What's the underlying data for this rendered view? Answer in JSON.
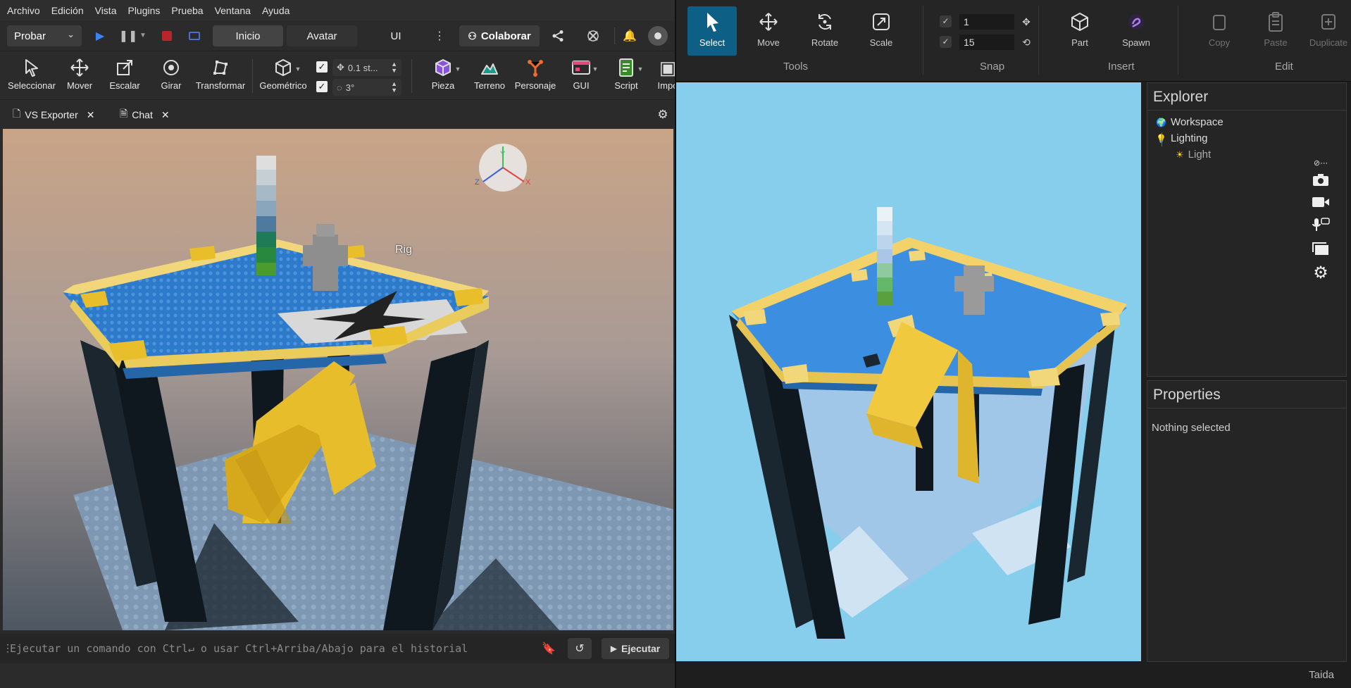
{
  "left_app": {
    "menu": [
      "Archivo",
      "Edición",
      "Vista",
      "Plugins",
      "Prueba",
      "Ventana",
      "Ayuda"
    ],
    "test_dropdown": "Probar",
    "modes": {
      "home": "Inicio",
      "avatar": "Avatar",
      "ui": "UI"
    },
    "collaborate": "Colaborar",
    "tools": {
      "select": "Seleccionar",
      "move": "Mover",
      "scale": "Escalar",
      "rotate": "Girar",
      "transform": "Transformar",
      "geometric": "Geométrico"
    },
    "snap": {
      "move": "0.1 st...",
      "rotate": "3°"
    },
    "insert": {
      "part": "Pieza",
      "terrain": "Terreno",
      "character": "Personaje",
      "gui": "GUI",
      "script": "Script",
      "import": "Impo"
    },
    "tabs": [
      "VS Exporter",
      "Chat"
    ],
    "viewport_label": "Rig",
    "gizmo": {
      "x": "X",
      "y": "Y",
      "z": "Z"
    },
    "command_placeholder": "Ejecutar un comando con Ctrl↵ o usar Ctrl+Arriba/Abajo para el historial",
    "run": "Ejecutar"
  },
  "right_app": {
    "tools": {
      "select": "Select",
      "move": "Move",
      "rotate": "Rotate",
      "scale": "Scale",
      "group": "Tools"
    },
    "snap": {
      "move_value": "1",
      "rotate_value": "15",
      "group": "Snap"
    },
    "insert": {
      "part": "Part",
      "spawn": "Spawn",
      "group": "Insert"
    },
    "edit": {
      "copy": "Copy",
      "paste": "Paste",
      "duplicate": "Duplicate",
      "group": "Edit"
    },
    "explorer": {
      "title": "Explorer",
      "items": [
        {
          "label": "Workspace"
        },
        {
          "label": "Lighting"
        },
        {
          "label": "Light"
        }
      ]
    },
    "properties": {
      "title": "Properties",
      "empty": "Nothing selected"
    },
    "status": "Taida"
  },
  "colors": {
    "accent": "#0e5f86",
    "sky": "#86ceeb",
    "blue_floor": "#3c8fe0",
    "yellow": "#f3d26a",
    "gold": "#e0b52e",
    "pillar": "#1d2b36"
  }
}
